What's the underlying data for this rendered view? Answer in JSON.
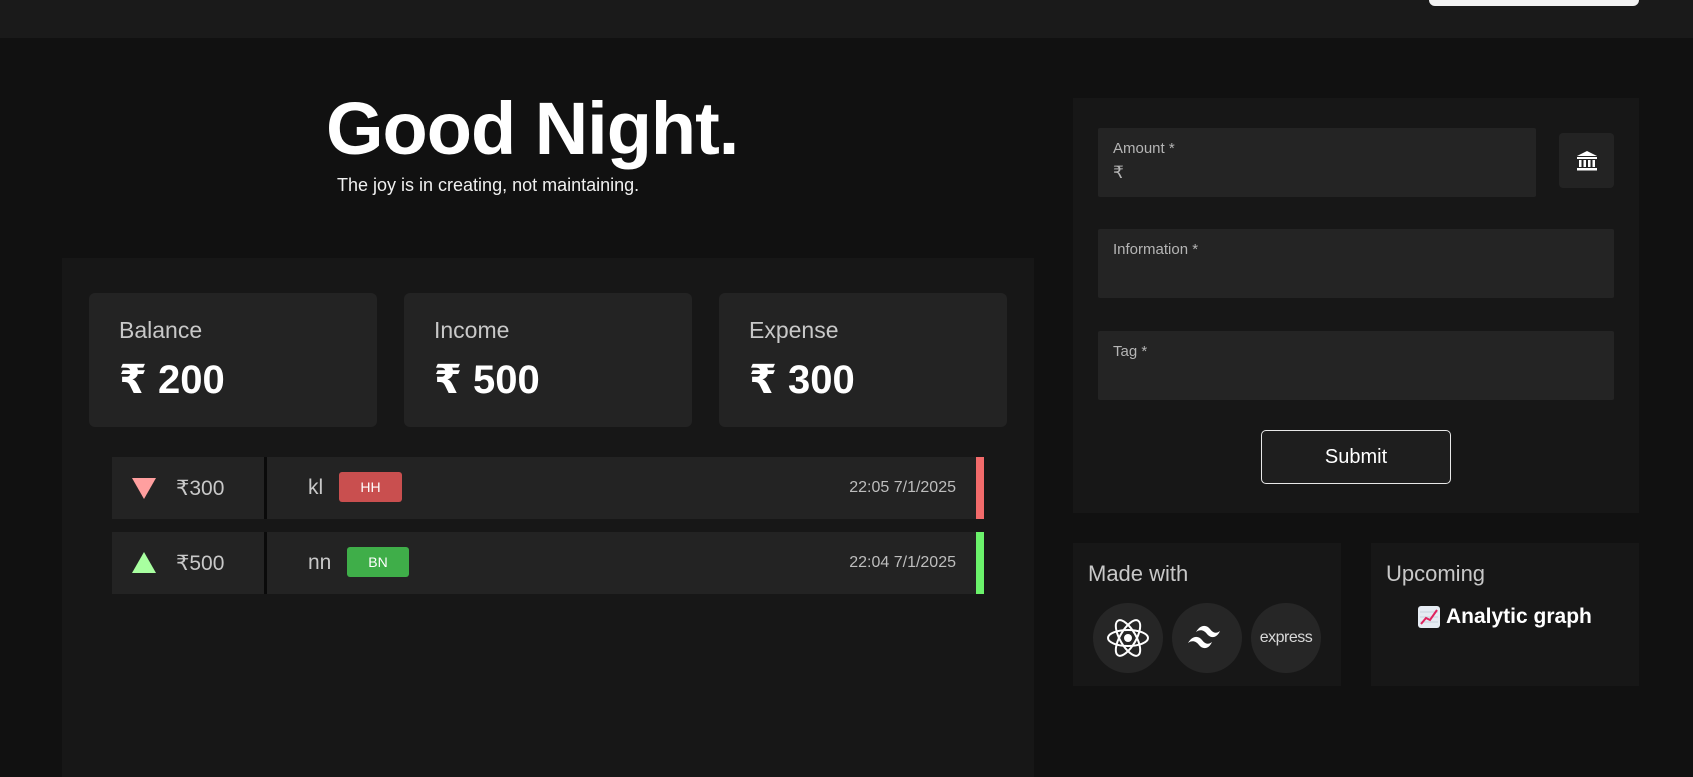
{
  "hero": {
    "title": "Good Night.",
    "subtitle": "The joy is in creating, not maintaining."
  },
  "stats": [
    {
      "label": "Balance",
      "value": "₹ 200"
    },
    {
      "label": "Income",
      "value": "₹ 500"
    },
    {
      "label": "Expense",
      "value": "₹ 300"
    }
  ],
  "transactions": [
    {
      "type": "expense",
      "amount": "₹300",
      "info": "kl",
      "tag": "HH",
      "time": "22:05 7/1/2025",
      "color": "#f26b6b",
      "tag_color": "#c94f4f",
      "arrow_color": "#ff9f9f"
    },
    {
      "type": "income",
      "amount": "₹500",
      "info": "nn",
      "tag": "BN",
      "time": "22:04 7/1/2025",
      "color": "#6bf26b",
      "tag_color": "#3fae49",
      "arrow_color": "#a8ffa0"
    }
  ],
  "form": {
    "amount_label": "Amount *",
    "amount_prefix": "₹",
    "information_label": "Information *",
    "tag_label": "Tag *",
    "submit_label": "Submit"
  },
  "made_with": {
    "title": "Made with",
    "items": [
      "react-icon",
      "tailwind-icon",
      "express"
    ]
  },
  "upcoming": {
    "title": "Upcoming",
    "item": "Analytic graph",
    "item_icon": "chart-increasing-icon"
  }
}
